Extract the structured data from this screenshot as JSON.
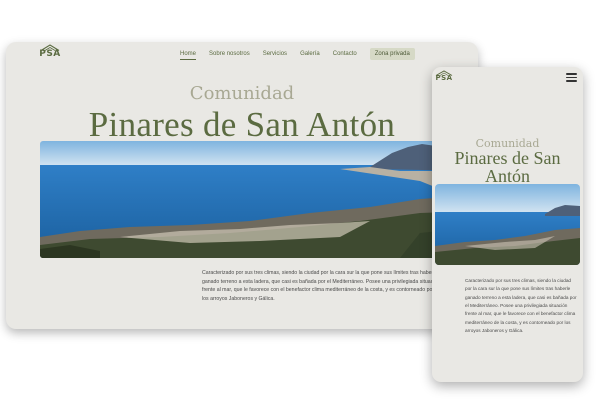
{
  "brand": {
    "logo_text": "PSA"
  },
  "nav": {
    "items": [
      {
        "label": "Home",
        "active": true
      },
      {
        "label": "Sobre nosotros",
        "active": false
      },
      {
        "label": "Servicios",
        "active": false
      },
      {
        "label": "Galería",
        "active": false
      },
      {
        "label": "Contacto",
        "active": false
      }
    ],
    "private_label": "Zona privada"
  },
  "hero": {
    "subtitle": "Comunidad",
    "title": "Pinares de San Antón"
  },
  "description": {
    "desktop": "Caracterizado por sus tres climas, siendo la ciudad por la cara sur la que pone sus límites tras haberle ganado terreno a esta ladera, que casi es bañada por el Mediterráneo. Posee una privilegiada situación frente al mar, que le favorece con el benefactor clima mediterráneo de la costa, y es contorneado por los arroyos Jaboneros y Gálica.",
    "mobile": "Caracterizado por sus tres climas, siendo la ciudad por la cara sur la que pone sus límites tras haberle ganado terreno a esta ladera, que casi es bañada por el Mediterráneo. Posee una privilegiada situación frente al mar, que le favorece con el benefactor clima mediterráneo de la costa, y es contorneado por los arroyos Jaboneros y Gálica."
  },
  "colors": {
    "brand_green": "#5b6b41",
    "subtitle_gray": "#a8a893",
    "panel_bg": "#e9e8e4",
    "private_button_bg": "#d6d9c6"
  },
  "icons": {
    "logo": "house-roof-icon",
    "menu": "hamburger-menu-icon"
  }
}
